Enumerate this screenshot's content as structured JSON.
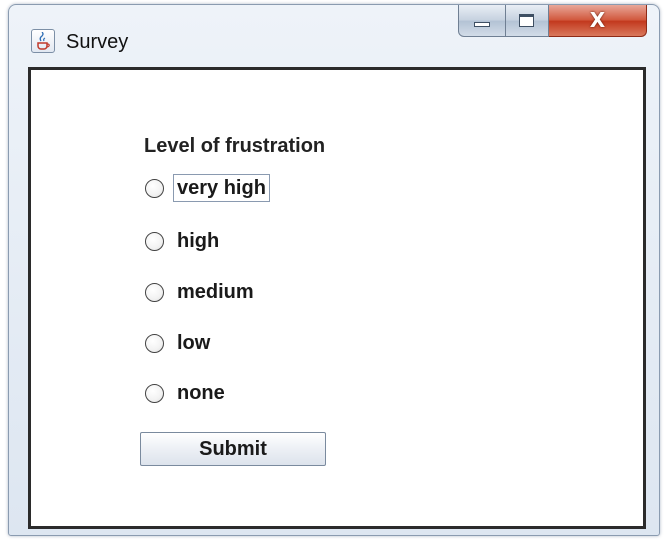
{
  "window": {
    "title": "Survey",
    "icon": "java-cup-icon",
    "controls": {
      "minimize": "minimize-icon",
      "maximize": "maximize-icon",
      "close": "close-icon",
      "close_glyph": "X"
    }
  },
  "form": {
    "question": "Level of frustration",
    "options": [
      {
        "label": "very high",
        "selected": false,
        "focused": true
      },
      {
        "label": "high",
        "selected": false,
        "focused": false
      },
      {
        "label": "medium",
        "selected": false,
        "focused": false
      },
      {
        "label": "low",
        "selected": false,
        "focused": false
      },
      {
        "label": "none",
        "selected": false,
        "focused": false
      }
    ],
    "submit_label": "Submit"
  },
  "colors": {
    "close_button": "#c2371c",
    "content_border": "#2b2b2b",
    "title_bar": "#dde6f1"
  }
}
